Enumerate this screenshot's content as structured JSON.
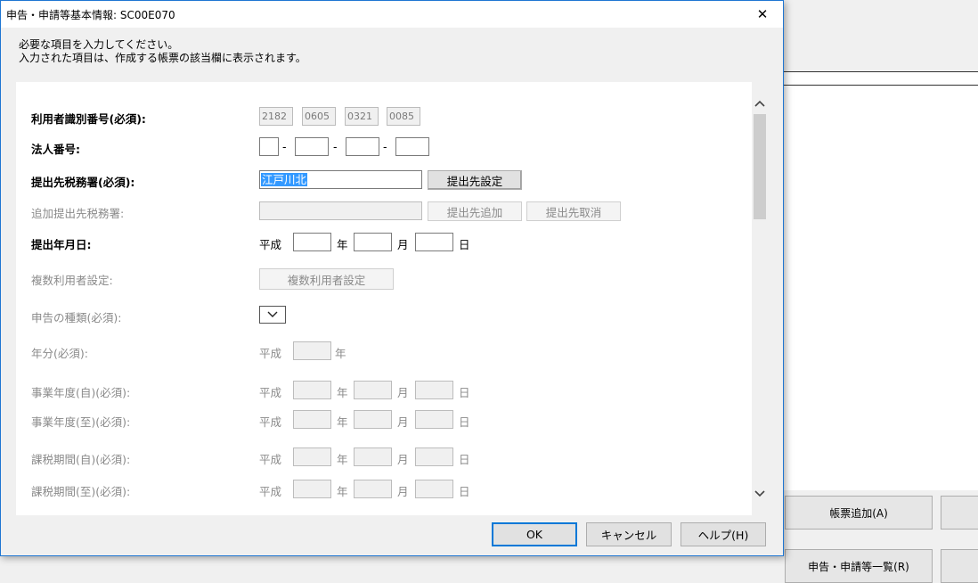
{
  "window": {
    "title": "申告・申請等基本情報: SC00E070",
    "close_glyph": "✕"
  },
  "instructions": {
    "line1": "必要な項目を入力してください。",
    "line2": "入力された項目は、作成する帳票の該当欄に表示されます。"
  },
  "era": "平成",
  "date_units": {
    "year": "年",
    "month": "月",
    "day": "日"
  },
  "dash": "-",
  "form": {
    "user_id": {
      "label": "利用者識別番号(必須):",
      "parts": [
        "2182",
        "0605",
        "0321",
        "0085"
      ]
    },
    "corp_number": {
      "label": "法人番号:"
    },
    "tax_office": {
      "label": "提出先税務署(必須):",
      "value": "江戸川北",
      "button": "提出先設定"
    },
    "additional_office": {
      "label": "追加提出先税務署:",
      "add_button": "提出先追加",
      "cancel_button": "提出先取消"
    },
    "submit_date": {
      "label": "提出年月日:"
    },
    "multi_user": {
      "label": "複数利用者設定:",
      "button": "複数利用者設定"
    },
    "declaration_type": {
      "label": "申告の種類(必須):"
    },
    "year_portion": {
      "label": "年分(必須):"
    },
    "fiscal_from": {
      "label": "事業年度(自)(必須):"
    },
    "fiscal_to": {
      "label": "事業年度(至)(必須):"
    },
    "tax_period_from": {
      "label": "課税期間(自)(必須):"
    },
    "tax_period_to": {
      "label": "課税期間(至)(必須):"
    }
  },
  "footer": {
    "ok": "OK",
    "cancel": "キャンセル",
    "help": "ヘルプ(H)"
  },
  "background": {
    "add_form_button": "帳票追加(A)",
    "list_button": "申告・申請等一覧(R)"
  }
}
